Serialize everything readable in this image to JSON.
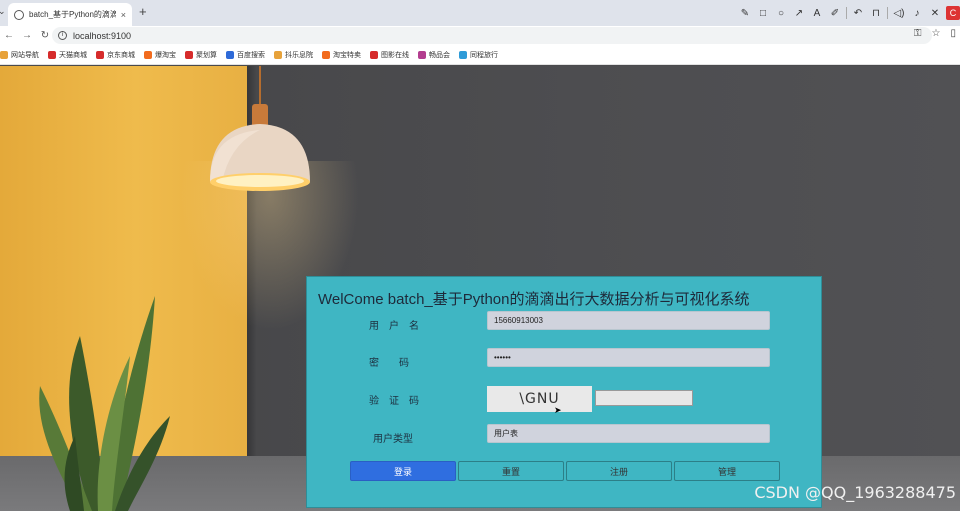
{
  "browser": {
    "tab_title": "batch_基于Python的滴滴出行...",
    "tab_close": "×",
    "tab_chevron": "⌄",
    "new_tab": "+",
    "address": "localhost:9100",
    "bookmarks": [
      {
        "label": "网站导航",
        "color": "#e7a23a"
      },
      {
        "label": "天猫商城",
        "color": "#d62b2b"
      },
      {
        "label": "京东商城",
        "color": "#d62b2b"
      },
      {
        "label": "爆淘宝",
        "color": "#f26b1d"
      },
      {
        "label": "聚划算",
        "color": "#d62b2b"
      },
      {
        "label": "百度搜索",
        "color": "#2e6ad8"
      },
      {
        "label": "抖乐息院",
        "color": "#e7a23a"
      },
      {
        "label": "淘宝特卖",
        "color": "#f26b1d"
      },
      {
        "label": "图影在线",
        "color": "#d62b2b"
      },
      {
        "label": "畅品会",
        "color": "#b33d8f"
      },
      {
        "label": "同程旅行",
        "color": "#2e9bd8"
      }
    ]
  },
  "login": {
    "title": "WelCome batch_基于Python的滴滴出行大数据分析与可视化系统",
    "username_label": "用　户　名",
    "username_value": "15660913003",
    "password_label": "密　　码",
    "password_value": "••••••",
    "captcha_label": "验　证　码",
    "captcha_text": "\\GNU",
    "captcha_input": "",
    "usertype_label": "用户类型",
    "usertype_value": "用户表",
    "buttons": [
      "登录",
      "重置",
      "注册",
      "管理"
    ]
  },
  "watermark": "CSDN @QQ_1963288475"
}
